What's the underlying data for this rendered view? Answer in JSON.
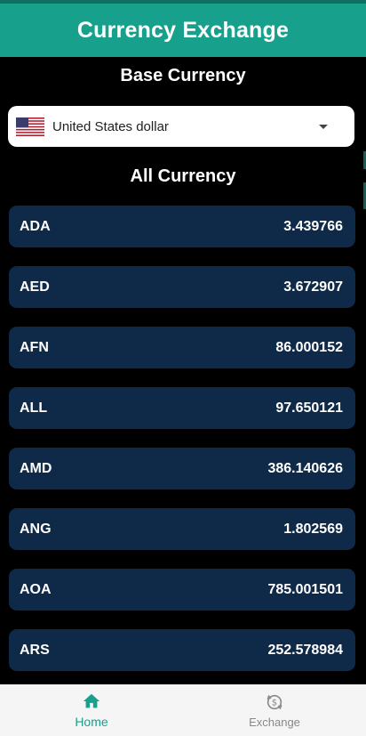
{
  "header": {
    "title": "Currency Exchange"
  },
  "base_currency": {
    "title": "Base Currency",
    "selected": "United States dollar",
    "flag_icon": "us-flag-icon"
  },
  "list": {
    "title": "All Currency",
    "rows": [
      {
        "code": "ADA",
        "rate": "3.439766"
      },
      {
        "code": "AED",
        "rate": "3.672907"
      },
      {
        "code": "AFN",
        "rate": "86.000152"
      },
      {
        "code": "ALL",
        "rate": "97.650121"
      },
      {
        "code": "AMD",
        "rate": "386.140626"
      },
      {
        "code": "ANG",
        "rate": "1.802569"
      },
      {
        "code": "AOA",
        "rate": "785.001501"
      },
      {
        "code": "ARS",
        "rate": "252.578984"
      }
    ]
  },
  "bottom_nav": {
    "home_label": "Home",
    "exchange_label": "Exchange",
    "active": "Home"
  },
  "colors": {
    "accent": "#17a08c",
    "row_bg": "#0e2a48",
    "background": "#000000"
  }
}
